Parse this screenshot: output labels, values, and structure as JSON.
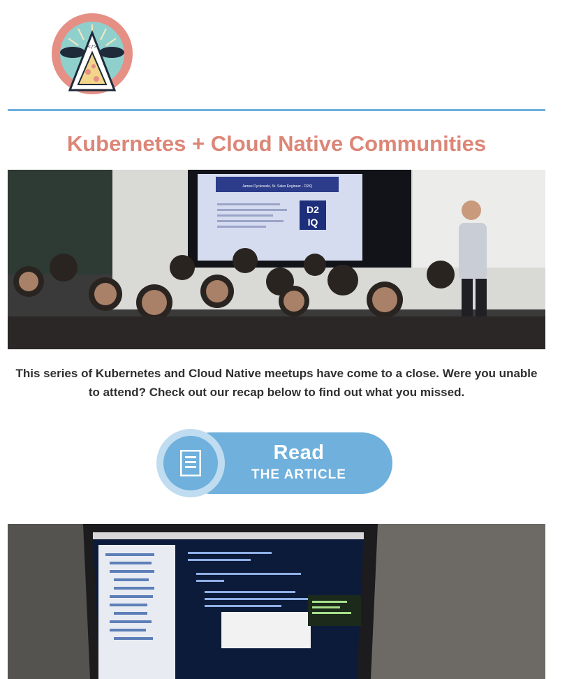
{
  "brand": {
    "logo_text": "I AM CLOUD NATIVE",
    "logo_code": "</>"
  },
  "headline": "Kubernetes + Cloud Native Communities",
  "hero_photo": {
    "slide_title": "James Dyckowski, Sr. Sales Engineer - D2IQ",
    "slide_logo_top": "D2",
    "slide_logo_bottom": "IQ"
  },
  "intro_text": "This series of Kubernetes and Cloud Native meetups have come to a close. Were you unable to attend? Check out our recap below to find out what you missed.",
  "cta": {
    "read_label": "Read",
    "sub_label": "THE ARTICLE"
  },
  "colors": {
    "headline": "#dc8677",
    "divider": "#6fb0dc",
    "button": "#6fb0dc",
    "body_text": "#2f2f2f"
  }
}
